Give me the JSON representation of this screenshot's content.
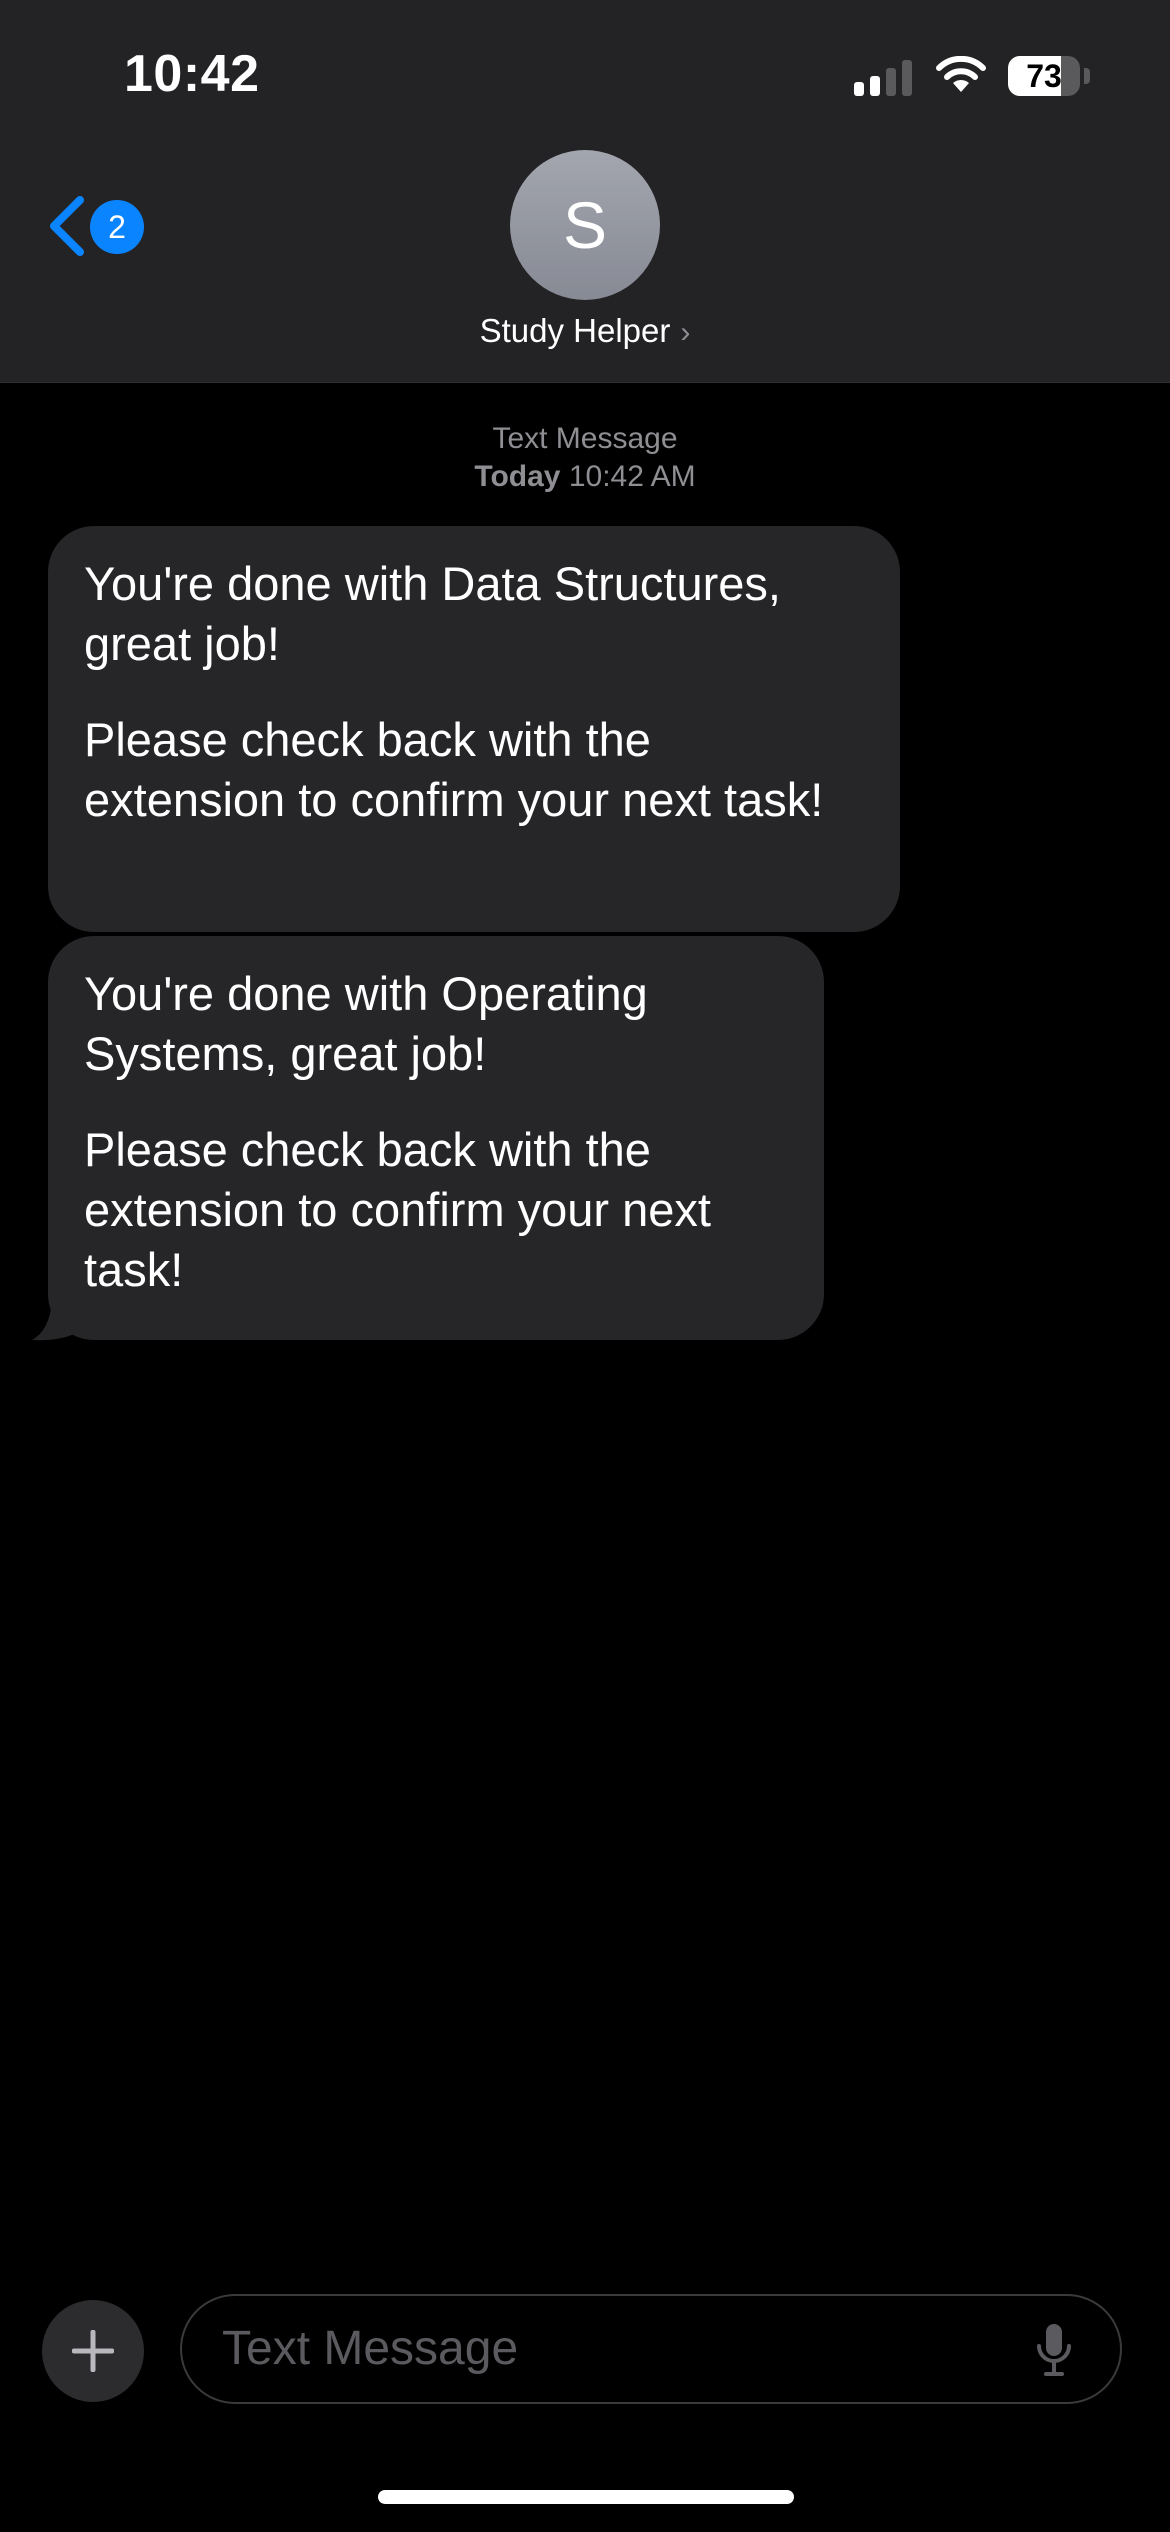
{
  "status_bar": {
    "time": "10:42",
    "battery_percent": "73",
    "battery_level": 0.73,
    "signal_bars_active": 2,
    "signal_bars_total": 4,
    "icons": [
      "cellular-signal-icon",
      "wifi-icon",
      "battery-icon"
    ]
  },
  "nav": {
    "back_badge": "2",
    "avatar_initial": "S",
    "contact_name": "Study Helper",
    "contact_chevron": "›"
  },
  "conversation": {
    "service_label": "Text Message",
    "timestamp_day": "Today",
    "timestamp_time": "10:42 AM",
    "messages": [
      {
        "direction": "incoming",
        "paragraphs": [
          "You're done with Data Structures, great job!",
          "Please check back with the extension to confirm your next task!"
        ]
      },
      {
        "direction": "incoming",
        "paragraphs": [
          "You're done with Operating Systems, great job!",
          "Please check back with the extension to confirm your next task!"
        ]
      }
    ]
  },
  "compose": {
    "placeholder": "Text Message",
    "add_icon": "plus-icon",
    "mic_icon": "microphone-icon"
  },
  "colors": {
    "accent": "#0a84ff",
    "bubble_incoming": "#262628",
    "header_bg": "#232325",
    "background": "#000000",
    "secondary_text": "#8e8e93"
  }
}
